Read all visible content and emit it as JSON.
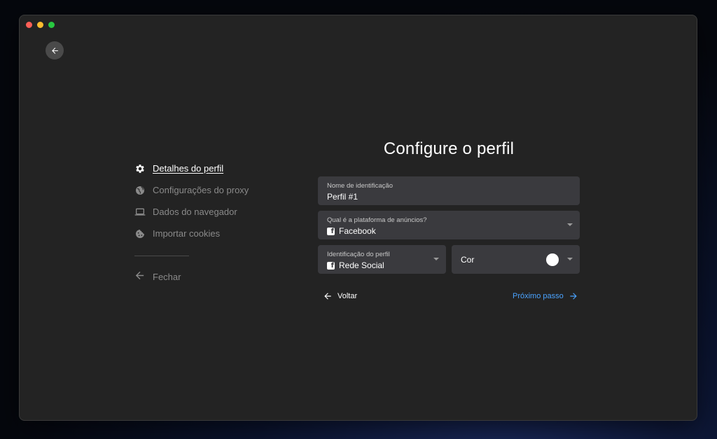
{
  "title": "Configure o perfil",
  "steps": [
    {
      "label": "Detalhes do perfil",
      "icon": "gear-icon",
      "active": true
    },
    {
      "label": "Configurações do proxy",
      "icon": "globe-icon",
      "active": false
    },
    {
      "label": "Dados do navegador",
      "icon": "laptop-icon",
      "active": false
    },
    {
      "label": "Importar cookies",
      "icon": "cookie-icon",
      "active": false
    }
  ],
  "close_label": "Fechar",
  "form": {
    "name": {
      "label": "Nome de identificação",
      "value": "Perfil #1"
    },
    "platform": {
      "label": "Qual é a plataforma de anúncios?",
      "value": "Facebook",
      "icon": "facebook-icon"
    },
    "profile_id": {
      "label": "Identificação do perfil",
      "value": "Rede Social",
      "icon": "facebook-icon"
    },
    "color": {
      "label": "Cor",
      "value": "#ffffff"
    }
  },
  "actions": {
    "back_label": "Voltar",
    "next_label": "Próximo passo"
  },
  "colors": {
    "accent": "#4aa3ff",
    "field_bg": "#3a3a3e",
    "window_bg": "#232323"
  }
}
